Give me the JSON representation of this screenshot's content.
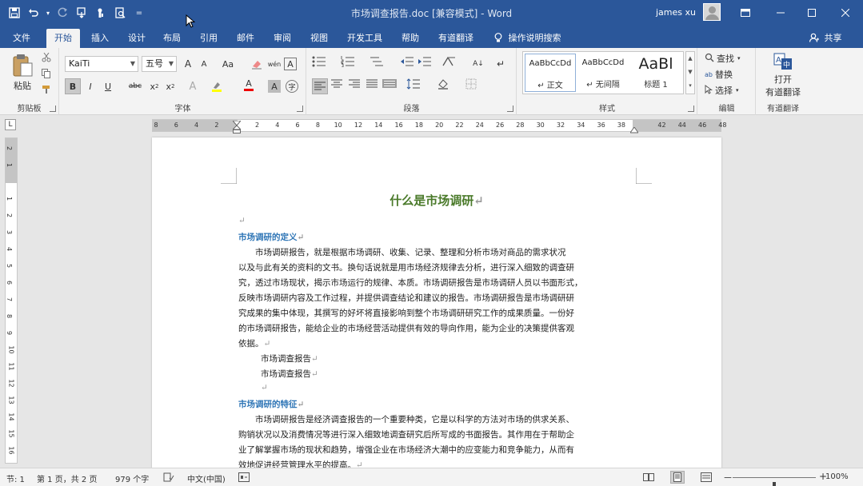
{
  "window": {
    "title": "市场调查报告.doc [兼容模式]  -  Word",
    "user": "james xu"
  },
  "qat": {
    "more_label": "="
  },
  "tabs": [
    "文件",
    "开始",
    "插入",
    "设计",
    "布局",
    "引用",
    "邮件",
    "审阅",
    "视图",
    "开发工具",
    "帮助",
    "有道翻译",
    "操作说明搜索"
  ],
  "share_label": "共享",
  "ribbon": {
    "clipboard": {
      "paste_label": "粘贴",
      "group_label": "剪贴板"
    },
    "font": {
      "font_name": "KaiTi",
      "font_size": "五号",
      "grow": "A",
      "shrink": "A",
      "change_case": "Aa",
      "phonetic": "wén",
      "char_border": "A",
      "bold": "B",
      "italic": "I",
      "underline": "U",
      "strike": "abc",
      "subscript": "x",
      "superscript": "x",
      "text_effects": "A",
      "font_color": "A",
      "char_shading": "A",
      "enclose": "字",
      "group_label": "字体"
    },
    "paragraph": {
      "group_label": "段落",
      "sort": "A↓",
      "marks": "↵"
    },
    "styles": {
      "items": [
        {
          "preview": "AaBbCcDd",
          "name": "↵ 正文"
        },
        {
          "preview": "AaBbCcDd",
          "name": "↵ 无间隔"
        },
        {
          "preview": "AaBl",
          "name": "标题 1"
        }
      ],
      "group_label": "样式"
    },
    "editing": {
      "find": "查找",
      "replace": "替换",
      "select": "选择",
      "group_label": "编辑"
    },
    "youdao": {
      "open_label": "打开",
      "translate_label": "有道翻译",
      "group_label": "有道翻译"
    }
  },
  "ruler": {
    "corner": "L",
    "ticks": [
      "8",
      "6",
      "4",
      "2",
      "",
      "2",
      "4",
      "6",
      "8",
      "10",
      "12",
      "14",
      "16",
      "18",
      "20",
      "22",
      "24",
      "26",
      "28",
      "30",
      "32",
      "34",
      "36",
      "38",
      "",
      "42",
      "44",
      "46",
      "48"
    ],
    "vticks": [
      "2",
      "1",
      "",
      "1",
      "2",
      "3",
      "4",
      "5",
      "6",
      "7",
      "8",
      "9",
      "10",
      "11",
      "12",
      "13",
      "14",
      "15",
      "16"
    ]
  },
  "document": {
    "title": "什么是市场调研",
    "pilcrow": "↵",
    "blank_mark": "↵",
    "heading1": "市场调研的定义",
    "para1": [
      "　　市场调研报告，就是根据市场调研、收集、记录、整理和分析市场对商品的需求状况",
      "以及与此有关的资料的文书。换句话说就是用市场经济规律去分析，进行深入细致的调查研",
      "究，透过市场现状，揭示市场运行的规律、本质。市场调研报告是市场调研人员以书面形式，",
      "反映市场调研内容及工作过程，并提供调查结论和建议的报告。市场调研报告是市场调研研",
      "究成果的集中体现，其撰写的好坏将直接影响到整个市场调研研究工作的成果质量。一份好",
      "的市场调研报告，能给企业的市场经营活动提供有效的导向作用，能为企业的决策提供客观",
      "依据。"
    ],
    "list_items": [
      "市场调查报告",
      "市场调查报告"
    ],
    "heading2": "市场调研的特征",
    "para2": [
      "　　市场调研报告是经济调查报告的一个重要种类，它是以科学的方法对市场的供求关系、",
      "购销状况以及消费情况等进行深入细致地调查研究后所写成的书面报告。其作用在于帮助企",
      "业了解掌握市场的现状和趋势，增强企业在市场经济大潮中的应变能力和竞争能力，从而有",
      "效地促进经营管理水平的提高。"
    ]
  },
  "status": {
    "section": "节: 1",
    "page": "第 1 页，共 2 页",
    "words": "979 个字",
    "language": "中文(中国)",
    "zoom_minus": "－",
    "zoom_plus": "+",
    "zoom": "100%",
    "zoom_level": 0.5
  },
  "colors": {
    "brand": "#2b579a",
    "title_green": "#4a7a2a",
    "heading_blue": "#2e75b6"
  }
}
